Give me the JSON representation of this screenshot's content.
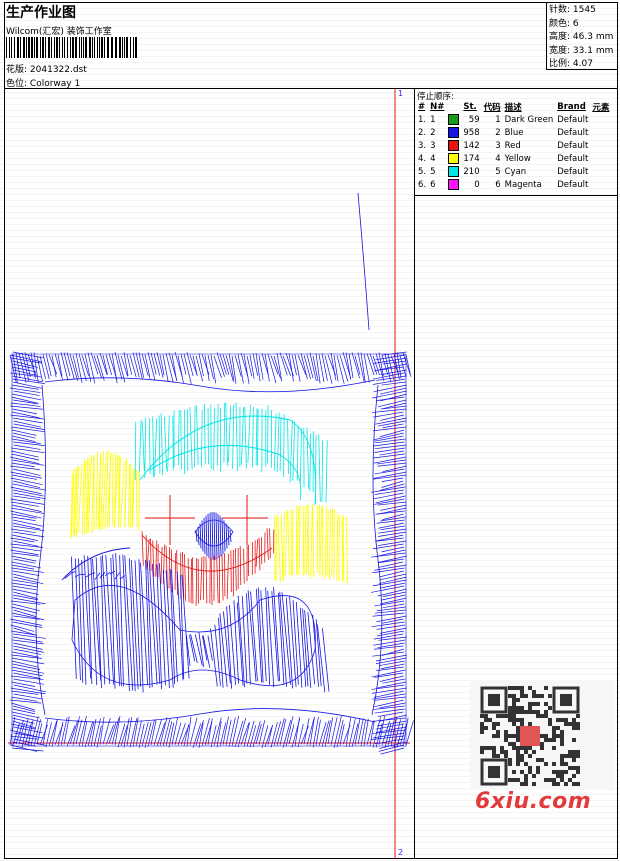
{
  "header": {
    "title": "生产作业图",
    "company": "Wilcom(汇宏) 装饰工作室",
    "design_label": "花版:",
    "design_value": "2041322.dst",
    "colorway_label": "色位:",
    "colorway_value": "Colorway 1"
  },
  "stats": [
    {
      "label": "针数:",
      "value": "1545"
    },
    {
      "label": "颜色:",
      "value": "6"
    },
    {
      "label": "高度:",
      "value": "46.3 mm"
    },
    {
      "label": "宽度:",
      "value": "33.1 mm"
    },
    {
      "label": "比例:",
      "value": "4.07"
    }
  ],
  "stop_sequence": {
    "title": "停止顺序:",
    "headers": [
      "#",
      "N#",
      "",
      "St.",
      "代码",
      "描述",
      "Brand",
      "元素"
    ],
    "rows": [
      {
        "idx": "1.",
        "n": "1",
        "color": "#1a9a1a",
        "st": "59",
        "code": "1",
        "desc": "Dark Green",
        "brand": "Default"
      },
      {
        "idx": "2.",
        "n": "2",
        "color": "#1414e6",
        "st": "958",
        "code": "2",
        "desc": "Blue",
        "brand": "Default"
      },
      {
        "idx": "3.",
        "n": "3",
        "color": "#e61414",
        "st": "142",
        "code": "3",
        "desc": "Red",
        "brand": "Default"
      },
      {
        "idx": "4.",
        "n": "4",
        "color": "#ffff00",
        "st": "174",
        "code": "4",
        "desc": "Yellow",
        "brand": "Default"
      },
      {
        "idx": "5.",
        "n": "5",
        "color": "#00e6e6",
        "st": "210",
        "code": "5",
        "desc": "Cyan",
        "brand": "Default"
      },
      {
        "idx": "6.",
        "n": "6",
        "color": "#ff14ff",
        "st": "0",
        "code": "6",
        "desc": "Magenta",
        "brand": "Default"
      }
    ]
  },
  "markers": {
    "top": "1",
    "bottom": "2"
  },
  "watermark": {
    "text": "6xiu.com"
  },
  "colors": {
    "blue": "#1414e6",
    "cyan": "#00e6e6",
    "yellow": "#ffff00",
    "red": "#e61414",
    "green": "#1a9a1a",
    "guide": "#e61414"
  }
}
